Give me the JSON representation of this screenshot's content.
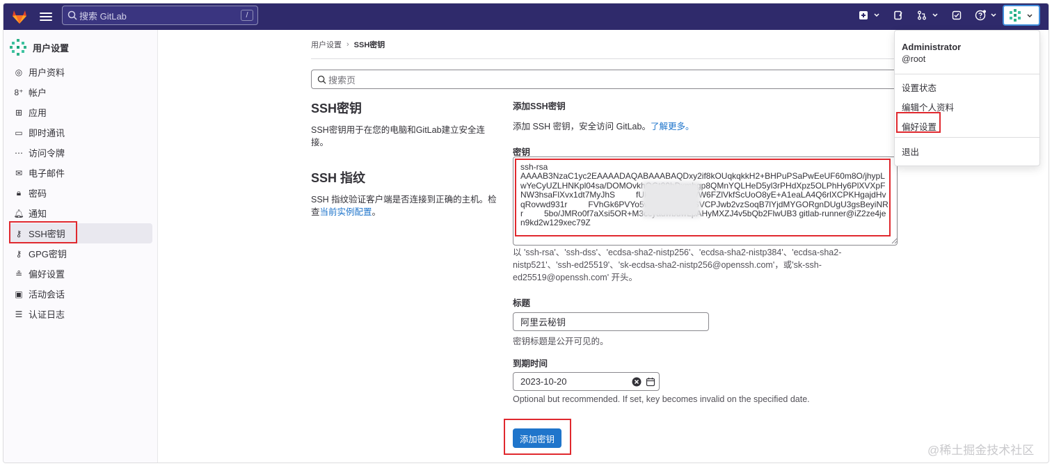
{
  "topbar": {
    "search_placeholder": "搜索 GitLab",
    "search_shortcut": "/",
    "accent": "#2f2a6b"
  },
  "sidebar": {
    "title": "用户设置",
    "items": [
      {
        "label": "用户资料",
        "icon": "profile-icon"
      },
      {
        "label": "帐户",
        "icon": "account-icon"
      },
      {
        "label": "应用",
        "icon": "applications-icon"
      },
      {
        "label": "即时通讯",
        "icon": "chat-icon"
      },
      {
        "label": "访问令牌",
        "icon": "token-icon"
      },
      {
        "label": "电子邮件",
        "icon": "mail-icon"
      },
      {
        "label": "密码",
        "icon": "lock-icon"
      },
      {
        "label": "通知",
        "icon": "bell-icon"
      },
      {
        "label": "SSH密钥",
        "icon": "key-icon",
        "active": true
      },
      {
        "label": "GPG密钥",
        "icon": "key-icon"
      },
      {
        "label": "偏好设置",
        "icon": "preferences-icon"
      },
      {
        "label": "活动会话",
        "icon": "monitor-icon"
      },
      {
        "label": "认证日志",
        "icon": "log-icon"
      }
    ]
  },
  "breadcrumb": {
    "parent": "用户设置",
    "current": "SSH密钥"
  },
  "page_search_placeholder": "搜索页",
  "ssh_section": {
    "title": "SSH密钥",
    "description": "SSH密钥用于在您的电脑和GitLab建立安全连接。"
  },
  "fingerprint_section": {
    "title": "SSH 指纹",
    "description_prefix": "SSH 指纹验证客户端是否连接到正确的主机。检查",
    "link": "当前实例配置",
    "description_suffix": "。"
  },
  "form": {
    "heading": "添加SSH密钥",
    "intro_text": "添加 SSH 密钥，安全访问 GitLab。",
    "intro_link": "了解更多。",
    "key_label": "密钥",
    "key_value": "ssh-rsa\nAAAAB3NzaC1yc2EAAAADAQABAAABAQDxy2if8kOUqkqkkH2+BHPuPSaPwEeUF60m8O/jhypLwYeCyUZLHNKpl04sa/DOMOvkhOGt80hDxmbgp8QMnYQLHeD5yl3rPHdXpz5OLPhHy6PlXVXpFNW3hsaFlXvx1dt7MyJhS         fUk4DWhf5+MWW6FZlVkfScUoO8yE+A1eaLA4Q6rlXCPKHgajdHvqRovwd931r         FVhGk6PVYo5wALSNa3r+pSVCPJwb2vzSoqB7lYjdMYGORgnDUgU3gsBeyiNRr         5bo/JMRo0f7aXsi5OR+M3ccyadwbuwLpAHyMXZJ4v5bQb2FlwUB3 gitlab-runner@iZ2ze4jen9kd2w129xec79Z",
    "key_hint": "以 'ssh-rsa'、'ssh-dss'、'ecdsa-sha2-nistp256'、'ecdsa-sha2-nistp384'、'ecdsa-sha2-nistp521'、'ssh-ed25519'、'sk-ecdsa-sha2-nistp256@openssh.com'，或'sk-ssh-ed25519@openssh.com' 开头。",
    "title_label": "标题",
    "title_value": "阿里云秘钥",
    "title_hint": "密钥标题是公开可见的。",
    "expiry_label": "到期时间",
    "expiry_value": "2023-10-20",
    "expiry_hint": "Optional but recommended. If set, key becomes invalid on the specified date.",
    "submit": "添加密钥"
  },
  "user_menu": {
    "name": "Administrator",
    "username": "@root",
    "items": [
      "设置状态",
      "编辑个人资料",
      "偏好设置"
    ],
    "signout": "退出"
  },
  "watermark": "@稀土掘金技术社区",
  "highlight_color": "#e0282e"
}
